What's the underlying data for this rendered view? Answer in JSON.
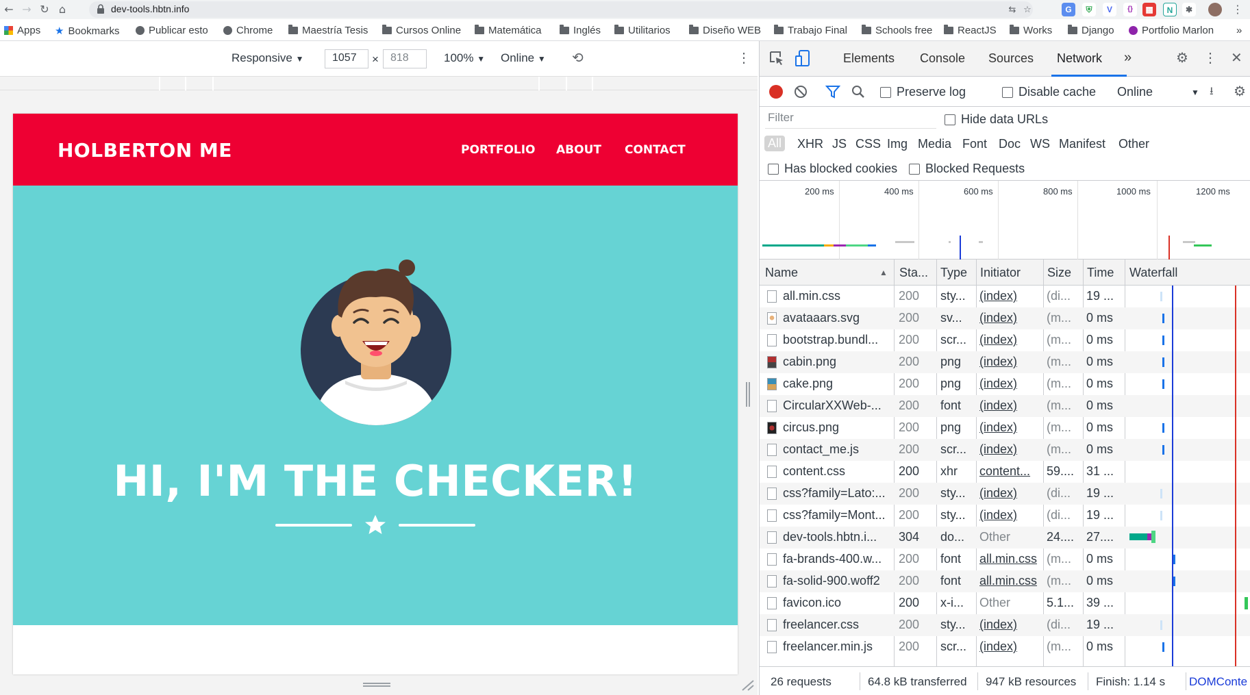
{
  "browser": {
    "url": "dev-tools.hbtn.info",
    "bookmarks": [
      "Apps",
      "Bookmarks",
      "Publicar esto",
      "Chrome",
      "Maestría Tesis",
      "Cursos Online",
      "Matemática",
      "Inglés",
      "Utilitarios",
      "Diseño WEB",
      "Trabajo Final",
      "Schools free",
      "ReactJS",
      "Works",
      "Django",
      "Portfolio Marlon"
    ],
    "more": "»"
  },
  "device_toolbar": {
    "mode": "Responsive",
    "width": "1057",
    "times": "×",
    "height": "818",
    "zoom": "100%",
    "throttle": "Online"
  },
  "site": {
    "brand": "HOLBERTON ME",
    "nav": [
      "PORTFOLIO",
      "ABOUT",
      "CONTACT"
    ],
    "hero_title": "HI, I'M THE CHECKER!",
    "colors": {
      "nav": "#ee0033",
      "masthead": "#66d3d4"
    }
  },
  "devtools": {
    "tabs": [
      "Elements",
      "Console",
      "Sources",
      "Network"
    ],
    "active_tab": "Network",
    "more_tabs": "»",
    "preserve_log": "Preserve log",
    "disable_cache": "Disable cache",
    "throttle": "Online",
    "filter_placeholder": "Filter",
    "hide_data_urls": "Hide data URLs",
    "type_filters": [
      "All",
      "XHR",
      "JS",
      "CSS",
      "Img",
      "Media",
      "Font",
      "Doc",
      "WS",
      "Manifest",
      "Other"
    ],
    "has_blocked_cookies": "Has blocked cookies",
    "blocked_requests": "Blocked Requests",
    "timeline_labels": [
      "200 ms",
      "400 ms",
      "600 ms",
      "800 ms",
      "1000 ms",
      "1200 ms"
    ],
    "columns": [
      "Name",
      "Sta...",
      "Type",
      "Initiator",
      "Size",
      "Time",
      "Waterfall"
    ],
    "requests": [
      {
        "name": "all.min.css",
        "status": "200",
        "type": "sty...",
        "initiator": "(index)",
        "size": "(di...",
        "time": "19 ..."
      },
      {
        "name": "avataaars.svg",
        "status": "200",
        "type": "sv...",
        "initiator": "(index)",
        "size": "(m...",
        "time": "0 ms"
      },
      {
        "name": "bootstrap.bundl...",
        "status": "200",
        "type": "scr...",
        "initiator": "(index)",
        "size": "(m...",
        "time": "0 ms"
      },
      {
        "name": "cabin.png",
        "status": "200",
        "type": "png",
        "initiator": "(index)",
        "size": "(m...",
        "time": "0 ms"
      },
      {
        "name": "cake.png",
        "status": "200",
        "type": "png",
        "initiator": "(index)",
        "size": "(m...",
        "time": "0 ms"
      },
      {
        "name": "CircularXXWeb-...",
        "status": "200",
        "type": "font",
        "initiator": "(index)",
        "size": "(m...",
        "time": "0 ms"
      },
      {
        "name": "circus.png",
        "status": "200",
        "type": "png",
        "initiator": "(index)",
        "size": "(m...",
        "time": "0 ms"
      },
      {
        "name": "contact_me.js",
        "status": "200",
        "type": "scr...",
        "initiator": "(index)",
        "size": "(m...",
        "time": "0 ms"
      },
      {
        "name": "content.css",
        "status": "200",
        "type": "xhr",
        "initiator": "content...",
        "size": "59....",
        "time": "31 ..."
      },
      {
        "name": "css?family=Lato:...",
        "status": "200",
        "type": "sty...",
        "initiator": "(index)",
        "size": "(di...",
        "time": "19 ..."
      },
      {
        "name": "css?family=Mont...",
        "status": "200",
        "type": "sty...",
        "initiator": "(index)",
        "size": "(di...",
        "time": "19 ..."
      },
      {
        "name": "dev-tools.hbtn.i...",
        "status": "304",
        "type": "do...",
        "initiator": "Other",
        "size": "24....",
        "time": "27...."
      },
      {
        "name": "fa-brands-400.w...",
        "status": "200",
        "type": "font",
        "initiator": "all.min.css",
        "size": "(m...",
        "time": "0 ms"
      },
      {
        "name": "fa-solid-900.woff2",
        "status": "200",
        "type": "font",
        "initiator": "all.min.css",
        "size": "(m...",
        "time": "0 ms"
      },
      {
        "name": "favicon.ico",
        "status": "200",
        "type": "x-i...",
        "initiator": "Other",
        "size": "5.1...",
        "time": "39 ..."
      },
      {
        "name": "freelancer.css",
        "status": "200",
        "type": "sty...",
        "initiator": "(index)",
        "size": "(di...",
        "time": "19 ..."
      },
      {
        "name": "freelancer.min.js",
        "status": "200",
        "type": "scr...",
        "initiator": "(index)",
        "size": "(m...",
        "time": "0 ms"
      }
    ],
    "summary": {
      "requests": "26 requests",
      "transferred": "64.8 kB transferred",
      "resources": "947 kB resources",
      "finish": "Finish: 1.14 s",
      "domcontent": "DOMConte"
    }
  }
}
